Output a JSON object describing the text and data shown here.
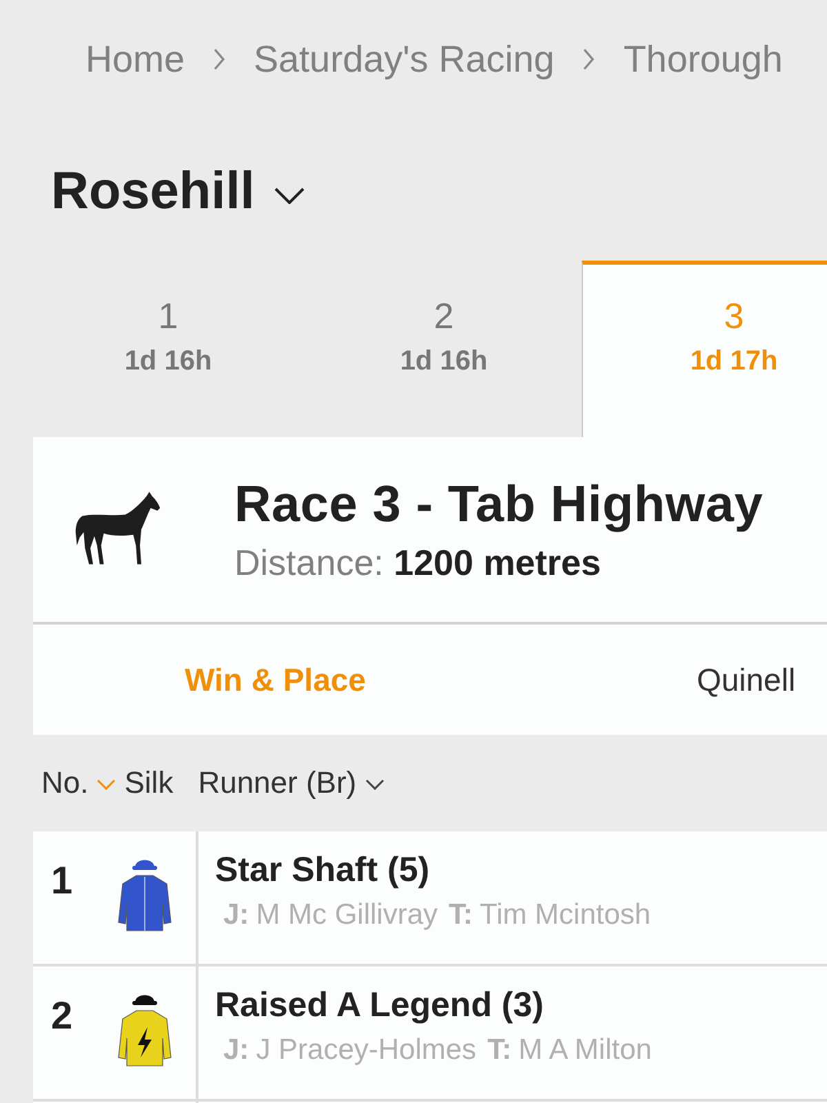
{
  "breadcrumb": [
    {
      "label": "Home"
    },
    {
      "label": "Saturday's Racing"
    },
    {
      "label": "Thorough"
    }
  ],
  "meeting": {
    "title": "Rosehill"
  },
  "race_tabs": [
    {
      "number": "1",
      "countdown": "1d 16h",
      "selected": false
    },
    {
      "number": "2",
      "countdown": "1d 16h",
      "selected": false
    },
    {
      "number": "3",
      "countdown": "1d 17h",
      "selected": true
    }
  ],
  "race": {
    "title": "Race 3 - Tab Highway",
    "distance_label": "Distance:",
    "distance": "1200 metres"
  },
  "market_tabs": [
    {
      "label": "Win & Place",
      "selected": true
    },
    {
      "label": "Quinell",
      "selected": false
    }
  ],
  "columns": [
    {
      "label": "No.",
      "kind": "sortable",
      "sorted": true
    },
    {
      "label": "Silk",
      "kind": "plain"
    },
    {
      "label": "Runner (Br)",
      "kind": "sortable",
      "sorted": false
    }
  ],
  "runners": [
    {
      "number": "1",
      "name": "Star Shaft (5)",
      "jockey_label": "J:",
      "jockey": "M Mc Gillivray",
      "trainer_label": "T:",
      "trainer": "Tim Mcintosh",
      "color": "#3355cc",
      "kind": "plain"
    },
    {
      "number": "2",
      "name": "Raised A Legend (3)",
      "jockey_label": "J:",
      "jockey": "J Pracey-Holmes",
      "trainer_label": "T:",
      "trainer": "M A Milton",
      "color": "#e8d21c",
      "kind": "lightning"
    }
  ]
}
